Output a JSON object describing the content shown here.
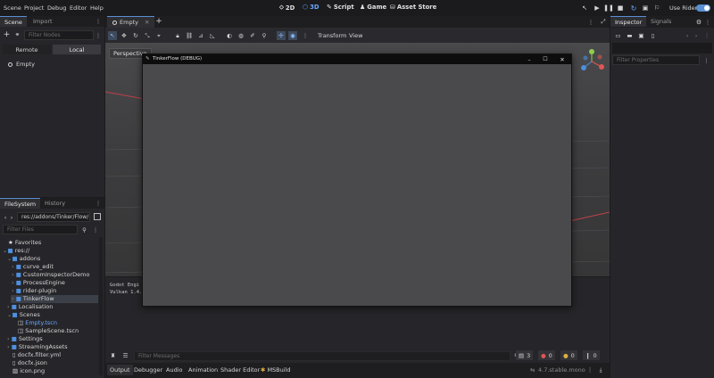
{
  "menu": [
    "Scene",
    "Project",
    "Debug",
    "Editor",
    "Help"
  ],
  "workspaces": [
    {
      "icon": "2d-icon",
      "glyph": "⬦",
      "label": "2D"
    },
    {
      "icon": "3d-icon",
      "glyph": "⬡",
      "label": "3D"
    },
    {
      "icon": "script-icon",
      "glyph": "✎",
      "label": "Script"
    },
    {
      "icon": "game-icon",
      "glyph": "♟",
      "label": "Game"
    },
    {
      "icon": "asset-store-icon",
      "glyph": "⛁",
      "label": "Asset Store"
    }
  ],
  "use_rider": "Use Rider",
  "scene_dock": {
    "tabs": [
      "Scene",
      "Import"
    ],
    "filter_placeholder": "Filter Nodes",
    "remote": "Remote",
    "local": "Local",
    "root_node": "Empty"
  },
  "editor_tabs": {
    "active": "Empty"
  },
  "viewport_toolbar": {
    "transform": "Transform",
    "view": "View",
    "perspective": "Perspective"
  },
  "game_window": {
    "title": "TinkerFlow (DEBUG)"
  },
  "output_text": [
    "Godot Engi",
    "Vulkan 1.4."
  ],
  "filesystem": {
    "tabs": [
      "FileSystem",
      "History"
    ],
    "path": "res://addons/Tinker/Flow/",
    "filter_placeholder": "Filter Files",
    "items": [
      {
        "label": "Favorites",
        "icon": "star-icon"
      },
      {
        "label": "res://",
        "icon": "folder-icon"
      },
      {
        "label": "addons",
        "icon": "folder-icon"
      },
      {
        "label": "curve_edit",
        "icon": "folder-icon"
      },
      {
        "label": "CustomInspectorDemo",
        "icon": "folder-icon"
      },
      {
        "label": "ProcessEngine",
        "icon": "folder-icon"
      },
      {
        "label": "rider-plugin",
        "icon": "folder-icon"
      },
      {
        "label": "TinkerFlow",
        "icon": "folder-icon"
      },
      {
        "label": "Localisation",
        "icon": "folder-icon"
      },
      {
        "label": "Scenes",
        "icon": "folder-icon"
      },
      {
        "label": "Empty.tscn",
        "icon": "scene-file-icon"
      },
      {
        "label": "SampleScene.tscn",
        "icon": "scene-file-icon"
      },
      {
        "label": "Settings",
        "icon": "folder-icon"
      },
      {
        "label": "StreamingAssets",
        "icon": "folder-icon"
      },
      {
        "label": "docfx.filter.yml",
        "icon": "file-icon"
      },
      {
        "label": "docfx.json",
        "icon": "file-icon"
      },
      {
        "label": "icon.png",
        "icon": "image-file-icon"
      }
    ]
  },
  "bottom_panel": {
    "filter_placeholder": "Filter Messages",
    "counts": {
      "info": "3",
      "errors": "0",
      "warnings": "0",
      "messages": "0"
    },
    "tabs": [
      "Output",
      "Debugger",
      "Audio",
      "Animation",
      "Shader Editor",
      "MSBuild"
    ],
    "version": "4.7.stable.mono"
  },
  "inspector": {
    "tabs": [
      "Inspector",
      "Signals"
    ],
    "filter_placeholder": "Filter Properties"
  },
  "colors": {
    "accent": "#5a8fd6",
    "folder": "#4e8fe0",
    "error": "#e05555",
    "warning": "#e0b040"
  }
}
